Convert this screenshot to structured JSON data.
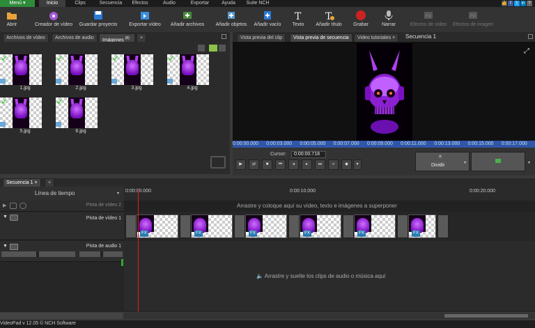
{
  "menubar": {
    "menu": "Menú",
    "tabs": [
      "Inicio",
      "Clips",
      "Secuencia",
      "Efectos",
      "Audio",
      "Exportar",
      "Ayuda",
      "Suite NCH"
    ],
    "active": "Inicio"
  },
  "toolbar": {
    "abrir": "Abrir",
    "creador": "Creador de vídeo",
    "guardar": "Guardar proyecto",
    "exportar": "Exportar vídeo",
    "anadir_archivos": "Añadir archivos",
    "anadir_objetos": "Añadir objetos",
    "anadir_vacio": "Añadir vacío",
    "texto": "Texto",
    "anadir_titulo": "Añadir título",
    "grabar": "Grabar",
    "narrar": "Narrar",
    "efectos_video": "Efectos de vídeo",
    "efectos_imagen": "Efectos de imagen"
  },
  "media_panel": {
    "tabs": [
      "Archivos de vídeo",
      "Archivos de audio",
      "Imágenes"
    ],
    "tab_count": "(6)",
    "add_tab": "+",
    "files": [
      "1.jpg",
      "2.jpg",
      "3.jpg",
      "4.jpg",
      "5.jpg",
      "6.jpg"
    ]
  },
  "preview_panel": {
    "tabs": [
      "Vista previa del clip",
      "Vista previa de secuencia",
      "Video tutoriales"
    ],
    "close": "×",
    "sequence_name": "Secuencia 1",
    "time_labels": [
      "0:00:00.000",
      "0:00:03.000",
      "0:00:05.000",
      "0:00:07.000",
      "0:00:09.000",
      "0:00:11.000",
      "0:00:13.000",
      "0:00:15.000",
      "0:00:17.000"
    ],
    "cursor_label": "Cursor:",
    "cursor_value": "0:00:00.718",
    "split_label": "Dividir"
  },
  "sequence": {
    "tab": "Secuencia 1",
    "add_tab": "+",
    "timeline_label": "Línea de tiempo",
    "ruler": [
      "0:00:00.000",
      "0:00:10.000",
      "0:00:20.000"
    ],
    "track_video2": "Pista de vídeo 2",
    "track_video1": "Pista de vídeo 1",
    "track_audio1": "Pista de audio 1",
    "overlay_hint": "Arrastre y coloque aquí su vídeo, texto e imágenes a superponer",
    "audio_hint": "Arrastre y suelte los clips de audio o música aquí",
    "fx": "FX"
  },
  "status": {
    "text": "VideoPad v 12.05 © NCH Software"
  },
  "colors": {
    "accent_green": "#2e8b3a",
    "timebar_blue": "#2f56a8",
    "skull_purple": "#9b30e0",
    "playhead_red": "#e02020"
  }
}
